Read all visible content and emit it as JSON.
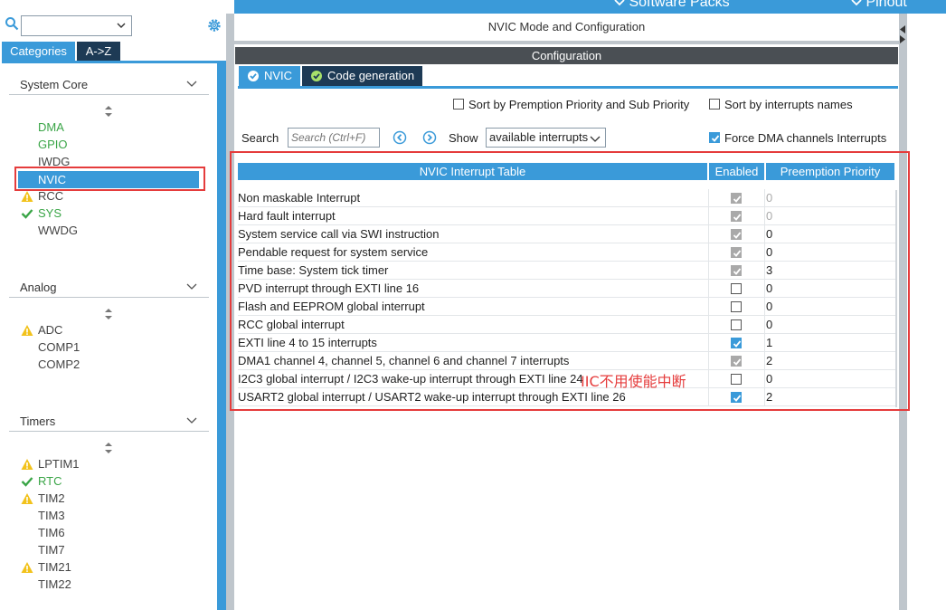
{
  "left_panel": {
    "search_value": "",
    "tabs": [
      "Categories",
      "A->Z"
    ],
    "sections": [
      {
        "title": "System Core",
        "items": [
          {
            "label": "DMA",
            "status": "none",
            "color": "#3aa547"
          },
          {
            "label": "GPIO",
            "status": "none",
            "color": "#3aa547"
          },
          {
            "label": "IWDG",
            "status": "none",
            "color": "#444444"
          },
          {
            "label": "NVIC",
            "status": "selected",
            "color": "#ffffff"
          },
          {
            "label": "RCC",
            "status": "warning",
            "color": "#444444"
          },
          {
            "label": "SYS",
            "status": "ok",
            "color": "#3aa547"
          },
          {
            "label": "WWDG",
            "status": "none",
            "color": "#444444"
          }
        ]
      },
      {
        "title": "Analog",
        "items": [
          {
            "label": "ADC",
            "status": "warning",
            "color": "#444444"
          },
          {
            "label": "COMP1",
            "status": "none",
            "color": "#444444"
          },
          {
            "label": "COMP2",
            "status": "none",
            "color": "#444444"
          }
        ]
      },
      {
        "title": "Timers",
        "items": [
          {
            "label": "LPTIM1",
            "status": "warning",
            "color": "#444444"
          },
          {
            "label": "RTC",
            "status": "ok",
            "color": "#3aa547"
          },
          {
            "label": "TIM2",
            "status": "warning",
            "color": "#444444"
          },
          {
            "label": "TIM3",
            "status": "none",
            "color": "#444444"
          },
          {
            "label": "TIM6",
            "status": "none",
            "color": "#444444"
          },
          {
            "label": "TIM7",
            "status": "none",
            "color": "#444444"
          },
          {
            "label": "TIM21",
            "status": "warning",
            "color": "#444444"
          },
          {
            "label": "TIM22",
            "status": "none",
            "color": "#444444"
          }
        ]
      }
    ]
  },
  "top_tabs": {
    "software_packs": "Software Packs",
    "pinout": "Pinout"
  },
  "main": {
    "mode_title": "NVIC Mode and Configuration",
    "config_title": "Configuration",
    "tabs": [
      "NVIC",
      "Code generation"
    ],
    "sort_premption": "Sort by Premption Priority and Sub Priority",
    "sort_names": "Sort by interrupts names",
    "search_label": "Search",
    "search_placeholder": "Search (Ctrl+F)",
    "show_label": "Show",
    "show_value": "available interrupts",
    "force_dma": "Force DMA channels Interrupts",
    "table": {
      "headers": [
        "NVIC Interrupt Table",
        "Enabled",
        "Preemption Priority"
      ],
      "rows": [
        {
          "name": "Non maskable Interrupt",
          "enabled": true,
          "locked": true,
          "priority": "0"
        },
        {
          "name": "Hard fault interrupt",
          "enabled": true,
          "locked": true,
          "priority": "0"
        },
        {
          "name": "System service call via SWI instruction",
          "enabled": true,
          "locked": true,
          "priority": "0"
        },
        {
          "name": "Pendable request for system service",
          "enabled": true,
          "locked": true,
          "priority": "0"
        },
        {
          "name": "Time base: System tick timer",
          "enabled": true,
          "locked": true,
          "priority": "3"
        },
        {
          "name": "PVD interrupt through EXTI line 16",
          "enabled": false,
          "locked": false,
          "priority": "0"
        },
        {
          "name": "Flash and EEPROM global interrupt",
          "enabled": false,
          "locked": false,
          "priority": "0"
        },
        {
          "name": "RCC global interrupt",
          "enabled": false,
          "locked": false,
          "priority": "0"
        },
        {
          "name": "EXTI line 4 to 15 interrupts",
          "enabled": true,
          "locked": false,
          "priority": "1"
        },
        {
          "name": "DMA1 channel 4, channel 5, channel 6 and channel 7 interrupts",
          "enabled": true,
          "locked": true,
          "priority": "2"
        },
        {
          "name": "I2C3 global interrupt / I2C3 wake-up interrupt through EXTI line 24",
          "enabled": false,
          "locked": false,
          "priority": "0"
        },
        {
          "name": "USART2 global interrupt / USART2 wake-up interrupt through EXTI line 26",
          "enabled": true,
          "locked": false,
          "priority": "2"
        }
      ]
    },
    "annotation": "IIC不用使能中断"
  },
  "colors": {
    "accent": "#3a9ad9",
    "dark_tab": "#1d3a55",
    "highlight": "#e53c3c",
    "ok": "#3aa547",
    "warning": "#f2c21b"
  }
}
